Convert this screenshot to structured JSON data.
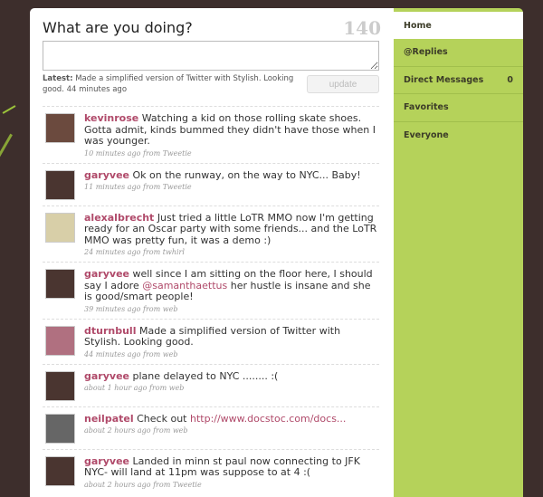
{
  "status": {
    "title": "What are you doing?",
    "char_count": "140",
    "latest_label": "Latest:",
    "latest_text": "Made a simplified version of Twitter with Stylish. Looking good. 44 minutes ago",
    "update_label": "update"
  },
  "nav": [
    {
      "label": "Home",
      "count": ""
    },
    {
      "label": "@Replies",
      "count": ""
    },
    {
      "label": "Direct Messages",
      "count": "0"
    },
    {
      "label": "Favorites",
      "count": ""
    },
    {
      "label": "Everyone",
      "count": ""
    }
  ],
  "tweets": [
    {
      "user": "kevinrose",
      "text": "Watching a kid on those rolling skate shoes. Gotta admit, kinds bummed they didn't have those when I was younger.",
      "meta": "10 minutes ago from Tweetie",
      "avatar": "#6b4a3e"
    },
    {
      "user": "garyvee",
      "text": "Ok on the runway, on the way to NYC... Baby!",
      "meta": "11 minutes ago from Tweetie",
      "avatar": "#4a3530"
    },
    {
      "user": "alexalbrecht",
      "text": "Just tried a little LoTR MMO now I'm getting ready for an Oscar party with some friends... and the LoTR MMO was pretty fun, it was a demo :)",
      "meta": "24 minutes ago from twhirl",
      "avatar": "#d8cfa8"
    },
    {
      "user": "garyvee",
      "text_a": "well since I am sitting on the floor here, I should say I adore ",
      "mention": "@samanthaettus",
      "text_b": " her hustle is insane and she is good/smart people!",
      "meta": "39 minutes ago from web",
      "avatar": "#4a3530"
    },
    {
      "user": "dturnbull",
      "text": "Made a simplified version of Twitter with Stylish. Looking good.",
      "meta": "44 minutes ago from web",
      "avatar": "#b07080"
    },
    {
      "user": "garyvee",
      "text": "plane delayed to NYC ........ :(",
      "meta": "about 1 hour ago from web",
      "avatar": "#4a3530"
    },
    {
      "user": "neilpatel",
      "text": "Check out",
      "link": "http://www.docstoc.com/docs...",
      "meta": "about 2 hours ago from web",
      "avatar": "#666"
    },
    {
      "user": "garyvee",
      "text": "Landed in minn st paul now connecting to JFK NYC- will land at 11pm was suppose to at 4 :(",
      "meta": "about 2 hours ago from Tweetie",
      "avatar": "#4a3530"
    }
  ]
}
